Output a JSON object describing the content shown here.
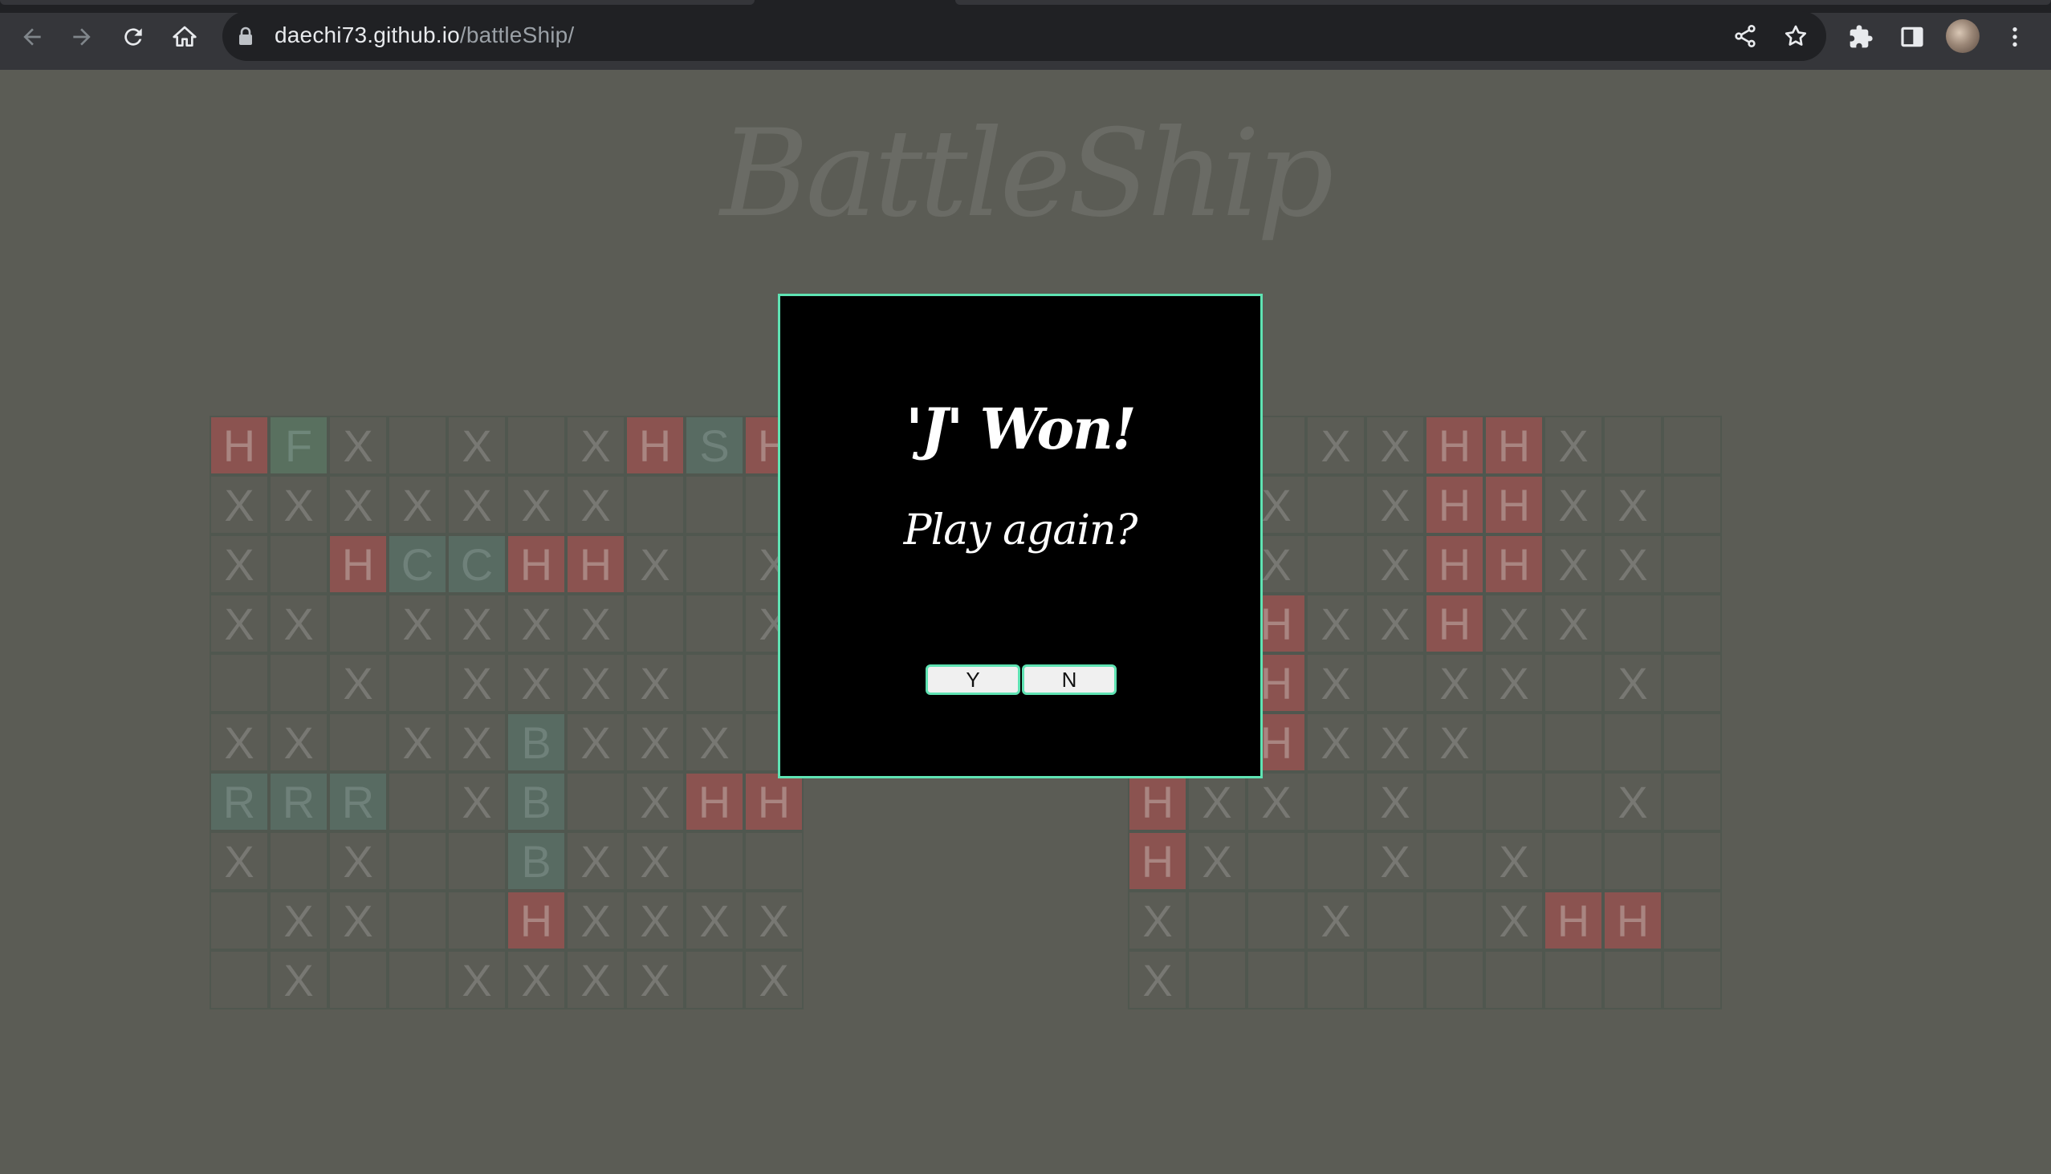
{
  "browser": {
    "url_host": "daechi73.github.io",
    "url_path": "/battleShip/"
  },
  "page": {
    "title": "BattleShip"
  },
  "boards": {
    "left": [
      [
        "H",
        "F",
        "X",
        "",
        "X",
        "",
        "X",
        "H",
        "S",
        "H"
      ],
      [
        "X",
        "X",
        "X",
        "X",
        "X",
        "X",
        "X",
        "",
        "",
        ""
      ],
      [
        "X",
        "",
        "H",
        "C",
        "C",
        "H",
        "H",
        "X",
        "",
        "X"
      ],
      [
        "X",
        "X",
        "",
        "X",
        "X",
        "X",
        "X",
        "",
        "",
        "X"
      ],
      [
        "",
        "",
        "X",
        "",
        "X",
        "X",
        "X",
        "X",
        "",
        ""
      ],
      [
        "X",
        "X",
        "",
        "X",
        "X",
        "B",
        "X",
        "X",
        "X",
        ""
      ],
      [
        "R",
        "R",
        "R",
        "",
        "X",
        "B",
        "",
        "X",
        "H",
        "H"
      ],
      [
        "X",
        "",
        "X",
        "",
        "",
        "B",
        "X",
        "X",
        "",
        ""
      ],
      [
        "",
        "X",
        "X",
        "",
        "",
        "H",
        "X",
        "X",
        "X",
        "X"
      ],
      [
        "",
        "X",
        "",
        "",
        "X",
        "X",
        "X",
        "X",
        "",
        "X"
      ]
    ],
    "right": [
      [
        "",
        "",
        "",
        "X",
        "X",
        "H",
        "H",
        "X",
        "",
        ""
      ],
      [
        "",
        "",
        "X",
        "",
        "X",
        "H",
        "H",
        "X",
        "X",
        ""
      ],
      [
        "",
        "",
        "X",
        "",
        "X",
        "H",
        "H",
        "X",
        "X",
        ""
      ],
      [
        "",
        "",
        "H",
        "X",
        "X",
        "H",
        "X",
        "X",
        "",
        ""
      ],
      [
        "",
        "",
        "H",
        "X",
        "",
        "X",
        "X",
        "",
        "X",
        ""
      ],
      [
        "",
        "",
        "H",
        "X",
        "X",
        "X",
        "",
        "",
        "",
        ""
      ],
      [
        "H",
        "X",
        "X",
        "",
        "X",
        "",
        "",
        "",
        "X",
        ""
      ],
      [
        "H",
        "X",
        "",
        "",
        "X",
        "",
        "X",
        "",
        "",
        ""
      ],
      [
        "X",
        "",
        "",
        "X",
        "",
        "",
        "X",
        "H",
        "H",
        ""
      ],
      [
        "X",
        "",
        "",
        "",
        "",
        "",
        "",
        "",
        "",
        ""
      ]
    ]
  },
  "modal": {
    "winner_text": "'J' Won!",
    "prompt": "Play again?",
    "yes_label": "Y",
    "no_label": "N"
  },
  "colors": {
    "background": "#5b5c55",
    "hit": "#8b5350",
    "ship": "#586b62",
    "modal_border": "#5fe3b3"
  }
}
